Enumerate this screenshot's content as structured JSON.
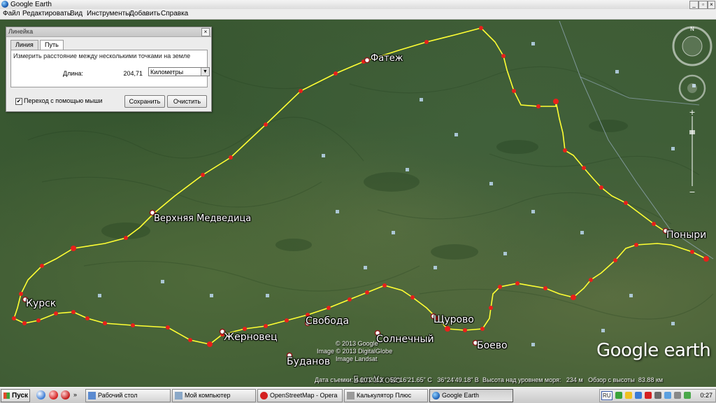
{
  "window": {
    "title": "Google Earth",
    "buttons": {
      "minimize": "_",
      "restore": "▫",
      "close": "×"
    }
  },
  "menu": [
    "Файл",
    "Редактировать",
    "Вид",
    "Инструменты",
    "Добавить",
    "Справка"
  ],
  "ruler": {
    "title": "Линейка",
    "close": "×",
    "tabs": [
      "Линия",
      "Путь"
    ],
    "active_tab": "Путь",
    "description": "Измерить расстояние между несколькими точками на земле",
    "length_label": "Длина:",
    "length_value": "204,71",
    "unit": "Километры",
    "mouse_nav_label": "Переход с помощью мыши",
    "mouse_nav_checked": true,
    "save_button": "Сохранить",
    "clear_button": "Очистить"
  },
  "places": {
    "fatezh": "Фатеж",
    "verkh_medveditsa": "Верхняя Медведица",
    "kursk": "Курск",
    "svoboda": "Свобода",
    "zhernovets": "Жерновец",
    "solnechny": "Солнечный",
    "shchurovo": "Щурово",
    "boevo": "Боево",
    "ponyri": "Поныри",
    "budanovka": "Буданов",
    "bottom_cut": "Бел Ухово"
  },
  "copyright": {
    "line1": "© 2013 Google",
    "line2": "Image © 2013 DigitalGlobe",
    "line3": "Image Landsat"
  },
  "logo": "Google earth",
  "status": {
    "date": "Дата съемки: 4.10.2013",
    "lat": "52°16'21.65\" С",
    "lon": "36°24'49.18\" В",
    "altitude": "Высота над уровнем моря:",
    "altitude_value": "234 м",
    "eye": "Обзор с высоты",
    "eye_value": "83.88 км"
  },
  "taskbar": {
    "start": "Пуск",
    "tasks": [
      "Рабочий стол",
      "Мой компьютер",
      "OpenStreetMap - Opera",
      "Калькулятор Плюс",
      "Google Earth"
    ],
    "active_task": "Google Earth",
    "lang": "RU",
    "clock": "0:27"
  },
  "colors": {
    "route": "#ffff33",
    "waypoint": "#e8201a",
    "accent": "#1d5fb4"
  }
}
